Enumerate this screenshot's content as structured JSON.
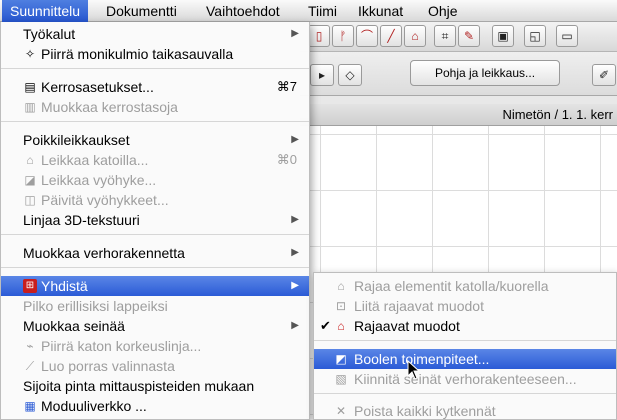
{
  "menubar": {
    "items": [
      "Suunnittelu",
      "Dokumentti",
      "Vaihtoehdot",
      "Tiimi",
      "Ikkunat",
      "Ohje"
    ]
  },
  "app": {
    "pohja_button": "Pohja ja leikkaus...",
    "window_title": "Nimetön / 1. 1. kerr"
  },
  "menu": {
    "tyokalut": "Työkalut",
    "piirra_monikulmio": "Piirrä monikulmio taikasauvalla",
    "kerrosasetukset": "Kerrosasetukset...",
    "kerrosasetukset_shortcut": "⌘7",
    "muokkaa_kerrostasoja": "Muokkaa kerrostasoja",
    "poikkileikkaukset": "Poikkileikkaukset",
    "leikkaa_katoilla": "Leikkaa katoilla...",
    "leikkaa_katoilla_shortcut": "⌘0",
    "leikkaa_vyohyke": "Leikkaa vyöhyke...",
    "paivita_vyohykkeet": "Päivitä vyöhykkeet...",
    "linjaa_3d": "Linjaa 3D-tekstuuri",
    "muokkaa_verhorakennetta": "Muokkaa verhorakennetta",
    "yhdista": "Yhdistä",
    "pilko": "Pilko erillisiksi lappeiksi",
    "muokkaa_seinaa": "Muokkaa seinää",
    "piirra_katon": "Piirrä katon korkeuslinja...",
    "luo_porras": "Luo porras valinnasta",
    "sijoita_pinta": "Sijoita pinta mittauspisteiden mukaan",
    "moduuliverkko": "Moduuliverkko ..."
  },
  "submenu": {
    "rajaa_elementit": "Rajaa elementit katolla/kuorella",
    "liita_rajaavat": "Liitä rajaavat muodot",
    "rajaavat_muodot": "Rajaavat muodot",
    "boolen": "Boolen toimenpiteet...",
    "kiinnita_seinat": "Kiinnitä seinät verhorakenteeseen...",
    "poista_kytkennat": "Poista kaikki kytkennät"
  },
  "colors": {
    "highlight": "#2b5bd6",
    "disabled_text": "#9e9e9e",
    "icon_red": "#c81e1e"
  }
}
